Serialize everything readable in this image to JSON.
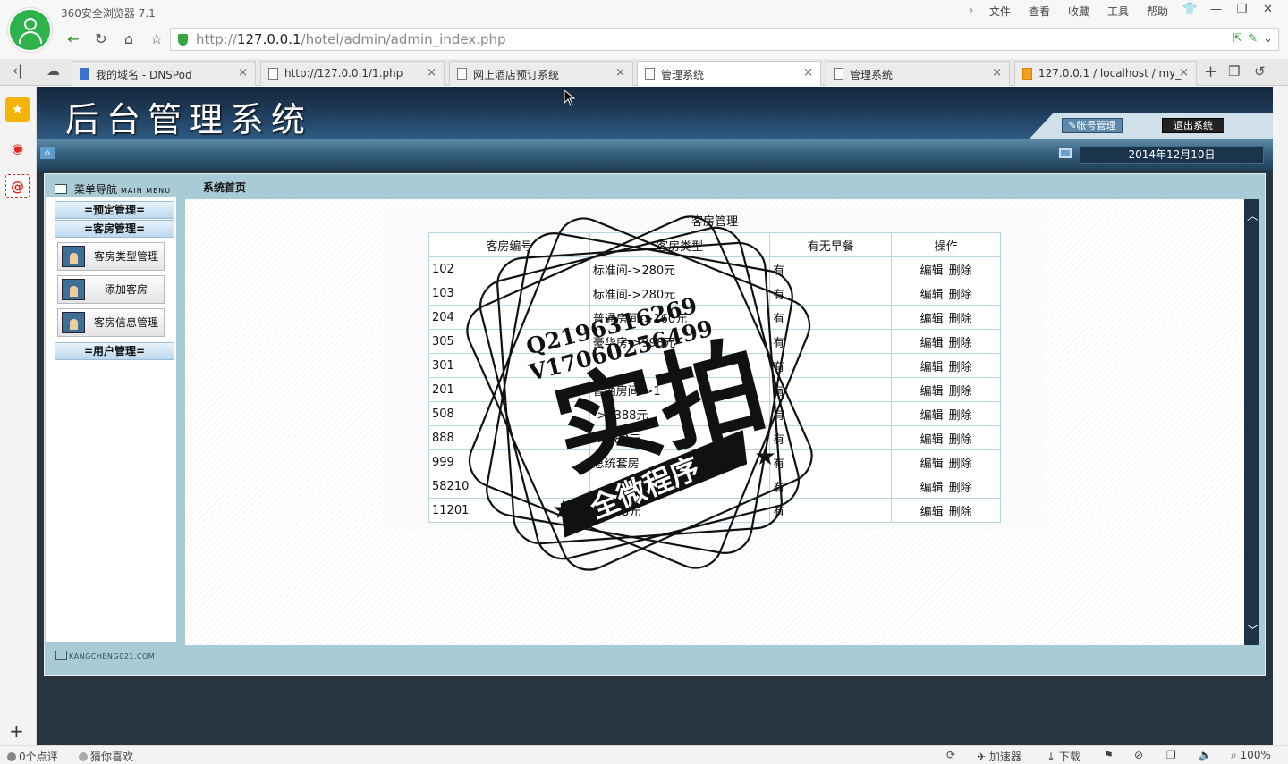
{
  "browser": {
    "app_title": "360安全浏览器 7.1",
    "menu": [
      "文件",
      "查看",
      "收藏",
      "工具",
      "帮助"
    ],
    "url_prefix": "http://",
    "url_host": "127.0.0.1",
    "url_path": "/hotel/admin/admin_index.php",
    "tabs": [
      {
        "label": "我的域名 - DNSPod",
        "icon": "dnspod-icon"
      },
      {
        "label": "http://127.0.0.1/1.php",
        "icon": "page-icon"
      },
      {
        "label": "网上酒店预订系统",
        "icon": "page-icon"
      },
      {
        "label": "管理系统",
        "icon": "page-icon",
        "active": true
      },
      {
        "label": "管理系统",
        "icon": "page-icon"
      },
      {
        "label": "127.0.0.1 / localhost / my_",
        "icon": "phpmyadmin-icon"
      }
    ],
    "status_left": [
      "0个点评",
      "猜你喜欢"
    ],
    "status_right": [
      "加速器",
      "下载",
      "100%"
    ]
  },
  "header": {
    "title": "后台管理系统",
    "account_label": "帐号管理",
    "logout_label": "退出系统",
    "date": "2014年12月10日"
  },
  "sidebar": {
    "title": "菜单导航",
    "title_en": "MAIN MENU",
    "groups": {
      "booking": "=预定管理=",
      "rooms": "=客房管理=",
      "users": "=用户管理="
    },
    "items": [
      "客房类型管理",
      "添加客房",
      "客房信息管理"
    ],
    "footer": "KANGCHENG021.COM"
  },
  "main": {
    "breadcrumb": "系统首页",
    "panel_title": "客房管理",
    "columns": [
      "客房编号",
      "客房类型",
      "有无早餐",
      "操作"
    ],
    "edit_label": "编辑",
    "delete_label": "删除",
    "rows": [
      {
        "id": "102",
        "type": "标准间->280元",
        "breakfast": "有"
      },
      {
        "id": "103",
        "type": "标准间->280元",
        "breakfast": "有"
      },
      {
        "id": "204",
        "type": "普通房间->160元",
        "breakfast": "有"
      },
      {
        "id": "305",
        "type": "豪华房->998元",
        "breakfast": "有"
      },
      {
        "id": "301",
        "type": "",
        "breakfast": "有"
      },
      {
        "id": "201",
        "type": "普通房间->1",
        "breakfast": "有"
      },
      {
        "id": "508",
        "type": "->1388元",
        "breakfast": "有"
      },
      {
        "id": "888",
        "type": "->188元",
        "breakfast": "有"
      },
      {
        "id": "999",
        "type": "总统套房",
        "breakfast": "有"
      },
      {
        "id": "58210",
        "type": "",
        "breakfast": "有"
      },
      {
        "id": "11201",
        "type": "->158元",
        "breakfast": "有"
      }
    ]
  },
  "watermark": {
    "qq": "Q2196316269",
    "wechat": "V17060256499",
    "big": "实拍",
    "ribbon": "全微程序"
  },
  "colors": {
    "banner": "#1e3a59",
    "frame": "#a9cbd6",
    "browser_green": "#2eb34a"
  }
}
